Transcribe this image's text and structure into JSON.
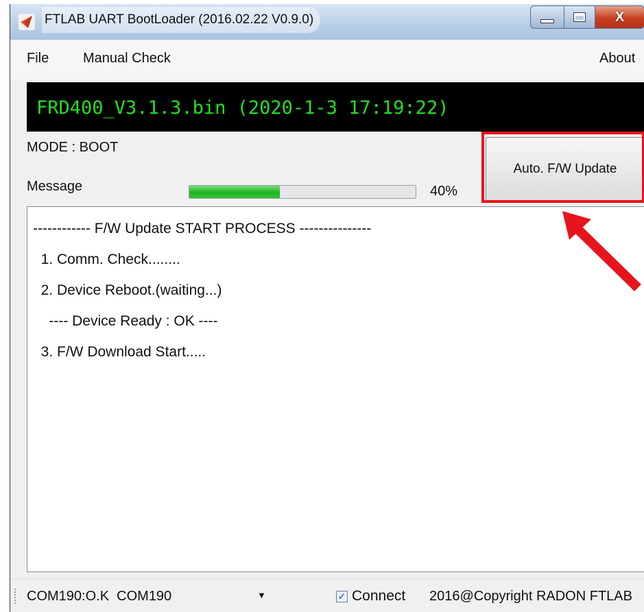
{
  "window": {
    "title": "FTLAB UART BootLoader (2016.02.22 V0.9.0)",
    "close_symbol": "X"
  },
  "menu": {
    "file": "File",
    "manual_check": "Manual Check",
    "about": "About"
  },
  "banner": {
    "filename": "FRD400_V3.1.3.bin (2020-1-3 17:19:22)",
    "text_color": "#21e021",
    "background": "#000000"
  },
  "status": {
    "mode": "MODE : BOOT",
    "message_label": "Message",
    "progress_percent": 40,
    "progress_text": "40%"
  },
  "update_button": {
    "label": "Auto. F/W Update"
  },
  "annotation": {
    "highlight_color": "#e8141b"
  },
  "log": {
    "lines": [
      "------------ F/W Update START PROCESS ---------------",
      "  1. Comm. Check........",
      "  2. Device Reboot.(waiting...)",
      "    ---- Device Ready : OK ----",
      "  3. F/W Download Start....."
    ]
  },
  "statusbar": {
    "port_status": "COM190:O.K  COM190",
    "connect_label": "Connect",
    "connect_checked": true,
    "copyright": "2016@Copyright RADON FTLAB"
  }
}
